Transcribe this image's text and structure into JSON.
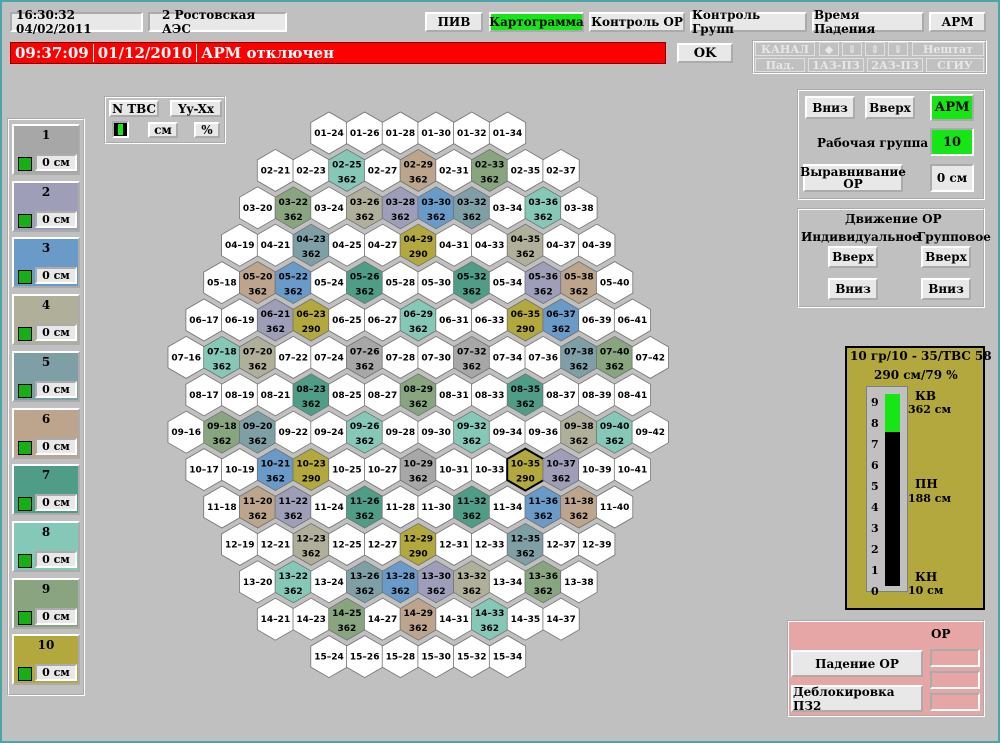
{
  "colors": {
    "g1": "#a7a7a7",
    "g2": "#9e9eb8",
    "g3": "#6a9ac8",
    "g4": "#b0b09a",
    "g5": "#7f9fa7",
    "g6": "#bca58c",
    "g7": "#4f9d86",
    "g8": "#86c8b8",
    "g9": "#89a57f",
    "g10": "#b3a83d"
  },
  "header": {
    "clock": "16:30:32  04/02/2011",
    "station": "2 Ростовская АЭС"
  },
  "nav": [
    "ПИВ",
    "Картограмма",
    "Контроль ОР",
    "Контроль Групп",
    "Время Падения",
    "АРМ"
  ],
  "nav_active": 1,
  "alarm": {
    "time": "09:37:09",
    "date": "01/12/2010",
    "message": "АРМ отключен",
    "ok": "OK"
  },
  "status": {
    "row1": [
      "КАНАЛ",
      "◆",
      "⇓",
      "⇕",
      "⇓",
      "Нештат"
    ],
    "row2": [
      "Пад.",
      "1АЗ-ПЗ",
      "2АЗ-ПЗ",
      "СГИУ"
    ]
  },
  "view_opts": {
    "ntvs": "N ТВС",
    "yyxx": "Yy-Xx",
    "cm": "см",
    "pct": "%"
  },
  "groups": [
    {
      "n": "1",
      "v": "0 см"
    },
    {
      "n": "2",
      "v": "0 см"
    },
    {
      "n": "3",
      "v": "0 см"
    },
    {
      "n": "4",
      "v": "0 см"
    },
    {
      "n": "5",
      "v": "0 см"
    },
    {
      "n": "6",
      "v": "0 см"
    },
    {
      "n": "7",
      "v": "0 см"
    },
    {
      "n": "8",
      "v": "0 см"
    },
    {
      "n": "9",
      "v": "0 см"
    },
    {
      "n": "10",
      "v": "0 см"
    }
  ],
  "core": {
    "rows": [
      {
        "r": "01",
        "cols": [
          "24",
          "26",
          "28",
          "30",
          "32",
          "34"
        ]
      },
      {
        "r": "02",
        "cols": [
          "21",
          "23",
          "25",
          "27",
          "29",
          "31",
          "33",
          "35",
          "37"
        ]
      },
      {
        "r": "03",
        "cols": [
          "20",
          "22",
          "24",
          "26",
          "28",
          "30",
          "32",
          "34",
          "36",
          "38"
        ]
      },
      {
        "r": "04",
        "cols": [
          "19",
          "21",
          "23",
          "25",
          "27",
          "29",
          "31",
          "33",
          "35",
          "37",
          "39"
        ]
      },
      {
        "r": "05",
        "cols": [
          "18",
          "20",
          "22",
          "24",
          "26",
          "28",
          "30",
          "32",
          "34",
          "36",
          "38",
          "40"
        ]
      },
      {
        "r": "06",
        "cols": [
          "17",
          "19",
          "21",
          "23",
          "25",
          "27",
          "29",
          "31",
          "33",
          "35",
          "37",
          "39",
          "41"
        ]
      },
      {
        "r": "07",
        "cols": [
          "16",
          "18",
          "20",
          "22",
          "24",
          "26",
          "28",
          "30",
          "32",
          "34",
          "36",
          "38",
          "40",
          "42"
        ]
      },
      {
        "r": "08",
        "cols": [
          "17",
          "19",
          "21",
          "23",
          "25",
          "27",
          "29",
          "31",
          "33",
          "35",
          "37",
          "39",
          "41"
        ]
      },
      {
        "r": "09",
        "cols": [
          "16",
          "18",
          "20",
          "22",
          "24",
          "26",
          "28",
          "30",
          "32",
          "34",
          "36",
          "38",
          "40",
          "42"
        ]
      },
      {
        "r": "10",
        "cols": [
          "17",
          "19",
          "21",
          "23",
          "25",
          "27",
          "29",
          "31",
          "33",
          "35",
          "37",
          "39",
          "41"
        ]
      },
      {
        "r": "11",
        "cols": [
          "18",
          "20",
          "22",
          "24",
          "26",
          "28",
          "30",
          "32",
          "34",
          "36",
          "38",
          "40"
        ]
      },
      {
        "r": "12",
        "cols": [
          "19",
          "21",
          "23",
          "25",
          "27",
          "29",
          "31",
          "33",
          "35",
          "37",
          "39"
        ]
      },
      {
        "r": "13",
        "cols": [
          "20",
          "22",
          "24",
          "26",
          "28",
          "30",
          "32",
          "34",
          "36",
          "38"
        ]
      },
      {
        "r": "14",
        "cols": [
          "21",
          "23",
          "25",
          "27",
          "29",
          "31",
          "33",
          "35",
          "37"
        ]
      },
      {
        "r": "15",
        "cols": [
          "24",
          "26",
          "28",
          "30",
          "32",
          "34"
        ]
      }
    ],
    "rods": {
      "02-25": [
        8,
        "362"
      ],
      "02-29": [
        6,
        "362"
      ],
      "02-33": [
        9,
        "362"
      ],
      "03-22": [
        9,
        "362"
      ],
      "03-26": [
        4,
        "362"
      ],
      "03-28": [
        2,
        "362"
      ],
      "03-30": [
        3,
        "362"
      ],
      "03-32": [
        5,
        "362"
      ],
      "03-36": [
        8,
        "362"
      ],
      "04-23": [
        5,
        "362"
      ],
      "04-29": [
        10,
        "290"
      ],
      "04-35": [
        4,
        "362"
      ],
      "05-20": [
        6,
        "362"
      ],
      "05-22": [
        3,
        "362"
      ],
      "05-26": [
        7,
        "362"
      ],
      "05-32": [
        7,
        "362"
      ],
      "05-36": [
        2,
        "362"
      ],
      "05-38": [
        6,
        "362"
      ],
      "06-21": [
        2,
        "362"
      ],
      "06-23": [
        10,
        "290"
      ],
      "06-29": [
        8,
        "362"
      ],
      "06-35": [
        10,
        "290"
      ],
      "06-37": [
        3,
        "362"
      ],
      "07-18": [
        8,
        "362"
      ],
      "07-20": [
        4,
        "362"
      ],
      "07-26": [
        1,
        "362"
      ],
      "07-32": [
        1,
        "362"
      ],
      "07-38": [
        5,
        "362"
      ],
      "07-40": [
        9,
        "362"
      ],
      "08-23": [
        7,
        "362"
      ],
      "08-29": [
        9,
        "362"
      ],
      "08-35": [
        7,
        "362"
      ],
      "09-18": [
        9,
        "362"
      ],
      "09-20": [
        5,
        "362"
      ],
      "09-26": [
        8,
        "362"
      ],
      "09-32": [
        8,
        "362"
      ],
      "09-38": [
        4,
        "362"
      ],
      "09-40": [
        8,
        "362"
      ],
      "10-21": [
        3,
        "362"
      ],
      "10-23": [
        10,
        "290"
      ],
      "10-29": [
        1,
        "362"
      ],
      "10-35": [
        10,
        "290"
      ],
      "10-37": [
        2,
        "362"
      ],
      "11-20": [
        6,
        "362"
      ],
      "11-22": [
        2,
        "362"
      ],
      "11-26": [
        7,
        "362"
      ],
      "11-32": [
        7,
        "362"
      ],
      "11-36": [
        3,
        "362"
      ],
      "11-38": [
        6,
        "362"
      ],
      "12-23": [
        4,
        "362"
      ],
      "12-29": [
        10,
        "290"
      ],
      "12-35": [
        5,
        "362"
      ],
      "13-22": [
        8,
        "362"
      ],
      "13-26": [
        5,
        "362"
      ],
      "13-28": [
        3,
        "362"
      ],
      "13-30": [
        2,
        "362"
      ],
      "13-32": [
        4,
        "362"
      ],
      "13-36": [
        9,
        "362"
      ],
      "14-25": [
        9,
        "362"
      ],
      "14-29": [
        6,
        "362"
      ],
      "14-33": [
        8,
        "362"
      ]
    },
    "selected": "10-35"
  },
  "control": {
    "down": "Вниз",
    "up": "Вверх",
    "arm": "АРМ",
    "work_group_label": "Рабочая группа",
    "work_group": "10",
    "align": "Выравнивание ОР",
    "align_val": "0 см"
  },
  "motion": {
    "title": "Движение ОР",
    "individual": "Индивидуальное",
    "group": "Групповое",
    "up": "Вверх",
    "down": "Вниз"
  },
  "rod_info": {
    "title": "10 гр/10 - 35/ТВС 58",
    "pos": "290 см/79 %",
    "kv": "КВ",
    "kv_val": "362 см",
    "pn": "ПН",
    "pn_val": "188 см",
    "kn": "КН",
    "kn_val": "10 см",
    "ticks": [
      "9",
      "8",
      "7",
      "6",
      "5",
      "4",
      "3",
      "2",
      "1",
      "0"
    ],
    "fill_fraction": 0.8
  },
  "or_panel": {
    "title": "ОР",
    "fall": "Падение ОР",
    "unblock": "Деблокировка ПЗ2"
  }
}
